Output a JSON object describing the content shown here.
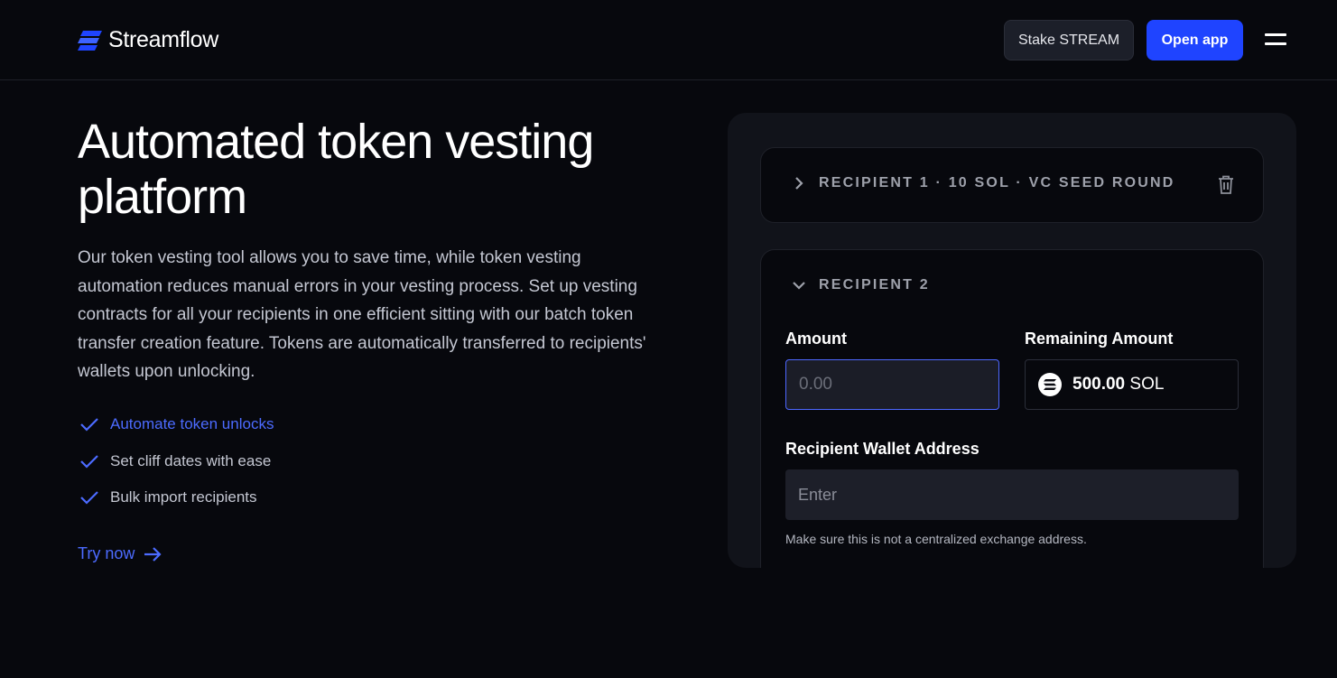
{
  "header": {
    "brand": "Streamflow",
    "stake_label": "Stake STREAM",
    "open_app_label": "Open app",
    "accent": "#1f44ff"
  },
  "hero": {
    "title": "Automated token vesting platform",
    "description": "Our token vesting tool allows you to save time, while token vesting automation reduces manual errors in your vesting process. Set up vesting contracts for all your recipients in one efficient sitting with our batch token transfer creation feature. Tokens are automatically transferred to recipients' wallets upon unlocking.",
    "features": [
      {
        "label": "Automate token unlocks",
        "active": true
      },
      {
        "label": "Set cliff dates with ease",
        "active": false
      },
      {
        "label": "Bulk import recipients",
        "active": false
      }
    ],
    "cta_label": "Try now"
  },
  "form": {
    "recipient1": {
      "title": "RECIPIENT 1 · 10 SOL · VC SEED ROUND",
      "expanded": false
    },
    "recipient2": {
      "title": "RECIPIENT 2",
      "expanded": true
    },
    "amount_label": "Amount",
    "amount_placeholder": "0.00",
    "amount_value": "",
    "remaining_label": "Remaining Amount",
    "remaining_amount": "500.00",
    "remaining_unit": "SOL",
    "wallet_label": "Recipient Wallet Address",
    "wallet_placeholder": "Enter",
    "wallet_value": "",
    "wallet_hint": "Make sure this is not a centralized exchange address."
  },
  "icons": {
    "logo": "streamflow-logo-icon",
    "menu": "hamburger-menu-icon",
    "check": "check-icon",
    "arrow": "arrow-right-icon",
    "chevron_collapsed": "chevron-right-icon",
    "chevron_expanded": "chevron-down-icon",
    "trash": "trash-icon",
    "token": "solana-icon"
  }
}
